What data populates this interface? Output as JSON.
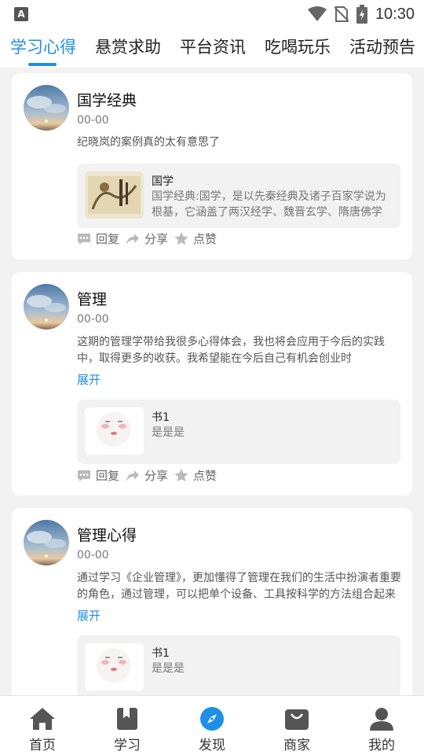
{
  "status_bar": {
    "time": "10:30"
  },
  "tabs": [
    {
      "label": "学习心得",
      "active": true
    },
    {
      "label": "悬赏求助"
    },
    {
      "label": "平台资讯"
    },
    {
      "label": "吃喝玩乐"
    },
    {
      "label": "活动预告"
    }
  ],
  "posts": [
    {
      "title": "国学经典",
      "date": "00-00",
      "body": "纪晓岚的案例真的太有意思了",
      "attachment": {
        "title": "国学",
        "desc": "国学经典:国学，是以先秦经典及诸子百家学说为根基，它涵盖了两汉经学、魏晋玄学、隋唐佛学"
      }
    },
    {
      "title": "管理",
      "date": "00-00",
      "body": "这期的管理学带给我很多心得体会，我也将会应用于今后的实践中，取得更多的收获。我希望能在今后自己有机会创业时",
      "expand_label": "展开",
      "attachment": {
        "title": "书1",
        "desc": "是是是"
      }
    },
    {
      "title": "管理心得",
      "date": "00-00",
      "body": "通过学习《企业管理》，更加懂得了管理在我们的生活中扮演者重要的角色，通过管理，可以把单个设备、工具按科学的方法组合起来",
      "expand_label": "展开",
      "attachment": {
        "title": "书1",
        "desc": "是是是"
      }
    }
  ],
  "actions": {
    "reply": "回复",
    "share": "分享",
    "like": "点赞"
  },
  "bottom_nav": [
    {
      "label": "首页",
      "icon": "home-icon"
    },
    {
      "label": "学习",
      "icon": "bookmark-icon"
    },
    {
      "label": "发现",
      "icon": "compass-icon",
      "active": true
    },
    {
      "label": "商家",
      "icon": "shopping-bag-icon"
    },
    {
      "label": "我的",
      "icon": "person-icon"
    }
  ],
  "colors": {
    "accent": "#1e8ee6",
    "background": "#f2f2f2",
    "icon_gray": "#555555",
    "action_gray": "#bbbbbb"
  }
}
